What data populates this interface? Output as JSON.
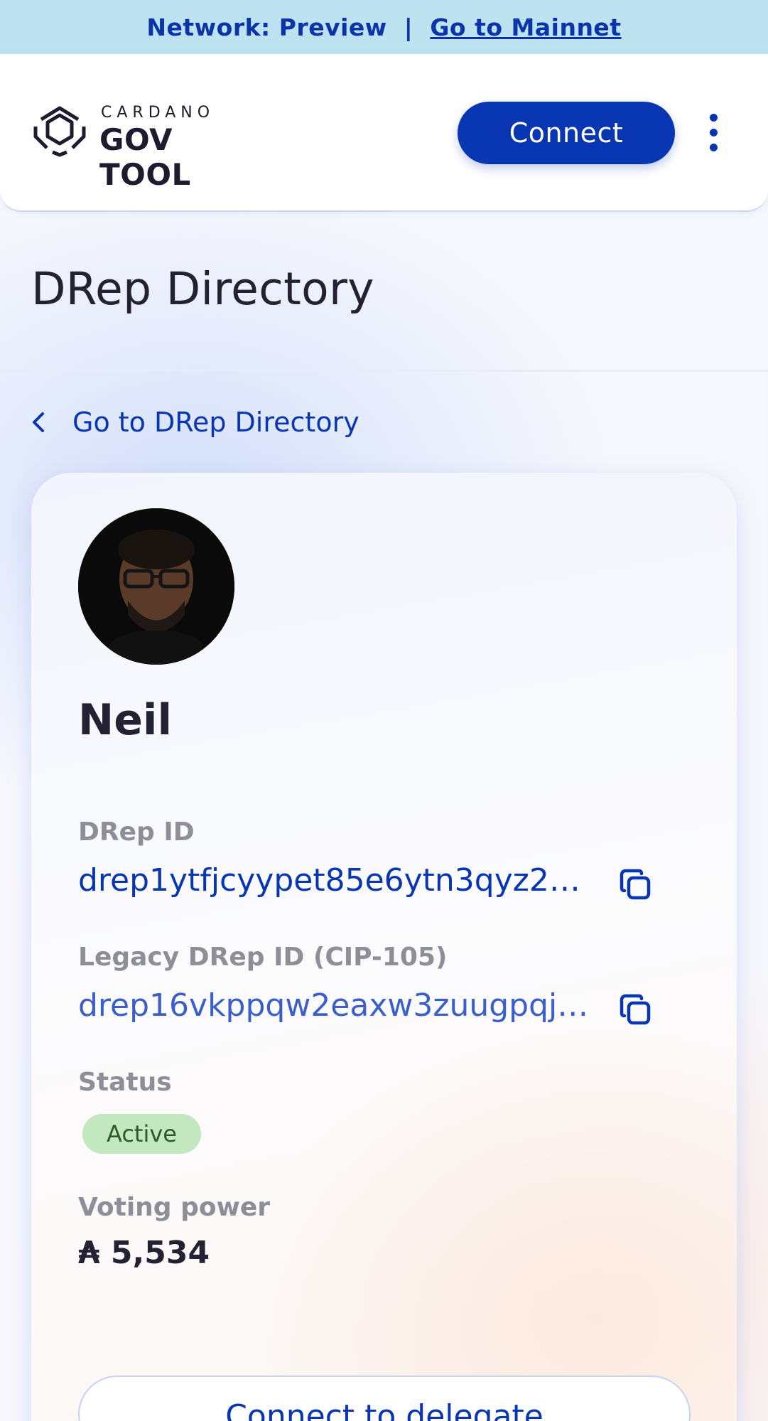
{
  "network_banner": {
    "network_label": "Network: Preview",
    "separator": "|",
    "mainnet_link": "Go to Mainnet"
  },
  "header": {
    "logo_top": "CARDANO",
    "logo_main": "GOV TOOL",
    "connect_label": "Connect"
  },
  "page": {
    "title": "DRep Directory",
    "back_link": "Go to DRep Directory"
  },
  "drep": {
    "name": "Neil",
    "drep_id_label": "DRep ID",
    "drep_id": "drep1ytfjcyypet85e6ytn3qyz2q…",
    "legacy_id_label": "Legacy DRep ID (CIP-105)",
    "legacy_id": "drep16vkppqw2eaxw3zuugpqjs…",
    "status_label": "Status",
    "status": "Active",
    "voting_power_label": "Voting power",
    "voting_power": "₳ 5,534",
    "delegate_label": "Connect to delegate"
  },
  "colors": {
    "accent": "#0836B3",
    "banner_bg": "#BDE3F0",
    "status_bg": "#C3E7BF",
    "status_text": "#2E5A2A"
  },
  "icons": [
    "cardano-gov-logo-icon",
    "kebab-menu-icon",
    "chevron-left-icon",
    "copy-icon"
  ]
}
